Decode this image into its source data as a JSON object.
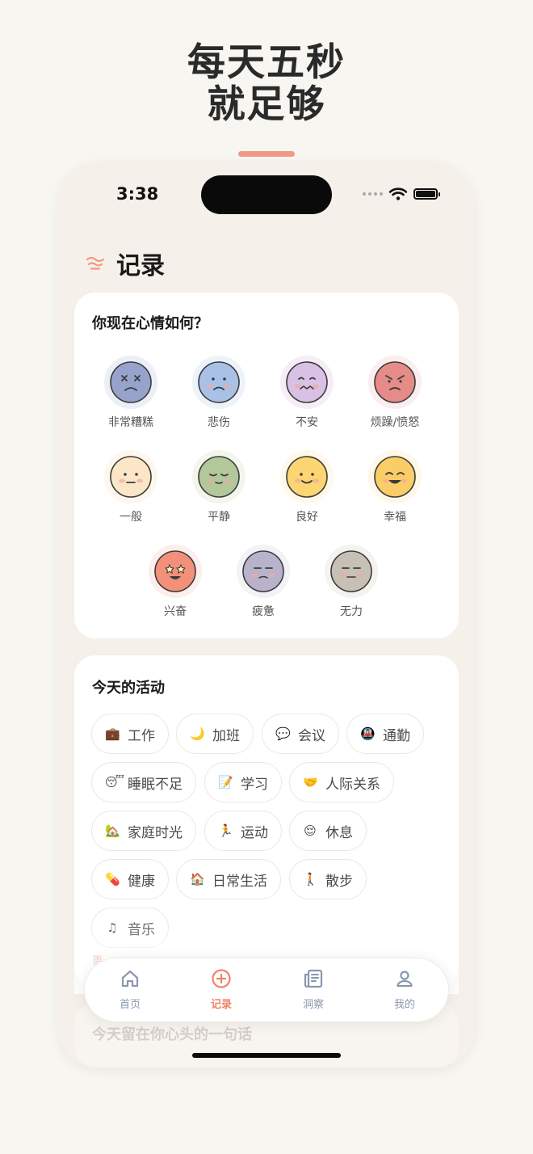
{
  "promo": {
    "line1": "每天五秒",
    "line2": "就足够"
  },
  "status": {
    "time": "3:38"
  },
  "header": {
    "title": "记录",
    "icon": "wave-menu-icon"
  },
  "mood_section": {
    "title": "你现在心情如何？",
    "moods": [
      {
        "label": "非常糟糕",
        "face": "#98a3cc",
        "halo": "#eceef8",
        "expr": "xx"
      },
      {
        "label": "悲伤",
        "face": "#a9c1e6",
        "halo": "#eef3fa",
        "expr": "sad"
      },
      {
        "label": "不安",
        "face": "#d8c1e4",
        "halo": "#f5eef8",
        "expr": "anxious"
      },
      {
        "label": "烦躁/愤怒",
        "face": "#e58b88",
        "halo": "#fbeeee",
        "expr": "angry"
      },
      {
        "label": "一般",
        "face": "#fbe7c8",
        "halo": "#fdf7ee",
        "expr": "neutral"
      },
      {
        "label": "平静",
        "face": "#b2c79a",
        "halo": "#f2f6ec",
        "expr": "calm"
      },
      {
        "label": "良好",
        "face": "#fbd672",
        "halo": "#fef9ea",
        "expr": "good"
      },
      {
        "label": "幸福",
        "face": "#fbcd67",
        "halo": "#fef8e8",
        "expr": "happy"
      },
      {
        "label": "兴奋",
        "face": "#f3907a",
        "halo": "#fcefeb",
        "expr": "excited"
      },
      {
        "label": "疲惫",
        "face": "#b8b3cb",
        "halo": "#f3f2f7",
        "expr": "tired"
      },
      {
        "label": "无力",
        "face": "#c7c0b5",
        "halo": "#f5f3f0",
        "expr": "weak"
      }
    ]
  },
  "activity_section": {
    "title": "今天的活动",
    "chips": [
      {
        "label": "工作",
        "icon": "💼"
      },
      {
        "label": "加班",
        "icon": "🌙"
      },
      {
        "label": "会议",
        "icon": "💬"
      },
      {
        "label": "通勤",
        "icon": "🚇"
      },
      {
        "label": "睡眠不足",
        "icon": "😴"
      },
      {
        "label": "学习",
        "icon": "📝"
      },
      {
        "label": "人际关系",
        "icon": "🤝"
      },
      {
        "label": "家庭时光",
        "icon": "🏡"
      },
      {
        "label": "运动",
        "icon": "🏃"
      },
      {
        "label": "休息",
        "icon": "😌"
      },
      {
        "label": "健康",
        "icon": "💊"
      },
      {
        "label": "日常生活",
        "icon": "🏠"
      },
      {
        "label": "散步",
        "icon": "🚶"
      },
      {
        "label": "音乐",
        "icon": "♫"
      }
    ]
  },
  "diary": {
    "title": "今天留在你心头的一句话"
  },
  "tabs": [
    {
      "label": "首页",
      "icon": "home-icon"
    },
    {
      "label": "记录",
      "icon": "plus-circle-icon"
    },
    {
      "label": "洞察",
      "icon": "newspaper-icon"
    },
    {
      "label": "我的",
      "icon": "user-icon"
    }
  ],
  "colors": {
    "accent": "#ef8468",
    "tab_inactive": "#8a98ad",
    "background": "#f8f6f1"
  }
}
